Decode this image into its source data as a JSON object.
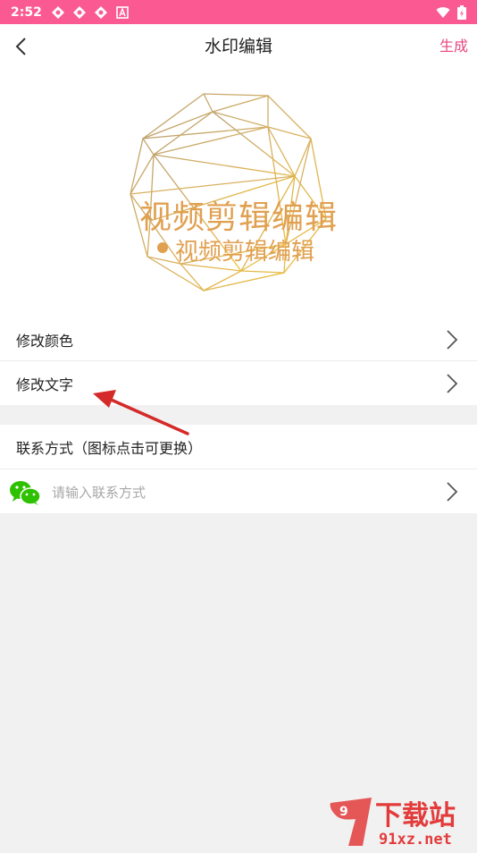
{
  "status_bar": {
    "time": "2:52"
  },
  "top_bar": {
    "title": "水印编辑",
    "generate_label": "生成"
  },
  "preview": {
    "watermark_text_main": "视频剪辑编辑",
    "watermark_text_sub": "视频剪辑编辑",
    "accent_color": "#e0a050"
  },
  "settings": {
    "modify_color_label": "修改颜色",
    "modify_text_label": "修改文字"
  },
  "contact": {
    "section_label": "联系方式（图标点击可更换）",
    "input_placeholder": "请输入联系方式",
    "input_value": ""
  },
  "site_logo": {
    "text_main": "下载站",
    "text_url": "91xz.net"
  },
  "colors": {
    "status_bar": "#fa5a91",
    "accent": "#e8457f",
    "wechat": "#2dc100",
    "background": "#f1f1f1"
  }
}
